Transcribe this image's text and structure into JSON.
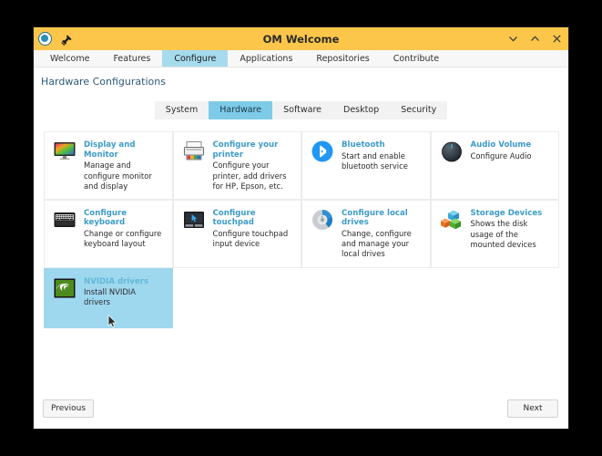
{
  "window": {
    "title": "OM Welcome",
    "app_icon": "om-logo-icon",
    "pin_icon": "pin-icon",
    "controls": [
      {
        "name": "minimize-button",
        "icon": "chevron-down-icon"
      },
      {
        "name": "maximize-button",
        "icon": "chevron-up-icon"
      },
      {
        "name": "close-button",
        "icon": "close-icon"
      }
    ]
  },
  "tabs": [
    {
      "label": "Welcome",
      "active": false
    },
    {
      "label": "Features",
      "active": false
    },
    {
      "label": "Configure",
      "active": true
    },
    {
      "label": "Applications",
      "active": false
    },
    {
      "label": "Repositories",
      "active": false
    },
    {
      "label": "Contribute",
      "active": false
    }
  ],
  "page": {
    "title": "Hardware Configurations"
  },
  "subtabs": [
    {
      "label": "System",
      "active": false
    },
    {
      "label": "Hardware",
      "active": true
    },
    {
      "label": "Software",
      "active": false
    },
    {
      "label": "Desktop",
      "active": false
    },
    {
      "label": "Security",
      "active": false
    }
  ],
  "cards": [
    {
      "title": "Display and Monitor",
      "desc": "Manage and configure monitor and display",
      "icon": "monitor-icon",
      "selected": false
    },
    {
      "title": "Configure your printer",
      "desc": "Configure your printer, add drivers for HP, Epson, etc.",
      "icon": "printer-icon",
      "selected": false
    },
    {
      "title": "Bluetooth",
      "desc": "Start and enable bluetooth service",
      "icon": "bluetooth-icon",
      "selected": false
    },
    {
      "title": "Audio Volume",
      "desc": "Configure Audio",
      "icon": "volume-knob-icon",
      "selected": false
    },
    {
      "title": "Configure keyboard",
      "desc": "Change or configure keyboard layout",
      "icon": "keyboard-icon",
      "selected": false
    },
    {
      "title": "Configure touchpad",
      "desc": "Configure touchpad input device",
      "icon": "touchpad-icon",
      "selected": false
    },
    {
      "title": "Configure local drives",
      "desc": "Change, configure and manage your local drives",
      "icon": "disk-icon",
      "selected": false
    },
    {
      "title": "Storage Devices",
      "desc": "Shows the disk usage of the mounted devices",
      "icon": "storage-blocks-icon",
      "selected": false
    },
    {
      "title": "NVIDIA drivers",
      "desc": "Install NVIDIA drivers",
      "icon": "nvidia-icon",
      "selected": true
    }
  ],
  "footer": {
    "previous_label": "Previous",
    "next_label": "Next"
  },
  "colors": {
    "titlebar": "#fcc64a",
    "active_tab": "#a6dbee",
    "active_subtab": "#7ecbe8",
    "selection": "#9ed8ef",
    "link": "#3d9bc9",
    "page_title": "#2d5a7a"
  }
}
